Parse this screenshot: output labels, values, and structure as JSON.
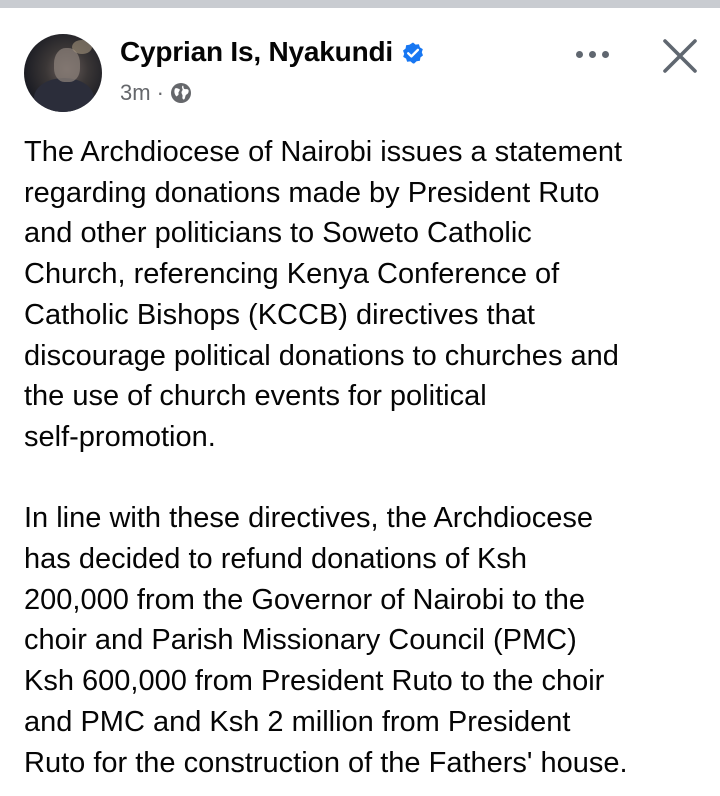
{
  "post": {
    "author": {
      "name": "Cyprian Is, Nyakundi",
      "verified_badge_icon": "verified-badge-icon",
      "avatar_icon": "profile-photo"
    },
    "timestamp": "3m",
    "separator": "·",
    "audience_icon": "globe-icon",
    "actions": {
      "more_icon": "more-options-icon",
      "close_icon": "close-icon"
    },
    "body": {
      "paragraph_1_lines": [
        "The Archdiocese of Nairobi issues a statement",
        "regarding donations made by President Ruto",
        "and other politicians to Soweto Catholic",
        "Church, referencing Kenya Conference of",
        "Catholic Bishops (KCCB) directives that",
        "discourage political donations to churches and",
        "the use of church events for political",
        "self-promotion."
      ],
      "paragraph_2_lines": [
        "In line with these directives, the Archdiocese",
        "has decided to refund donations of Ksh",
        "200,000 from the Governor of Nairobi to the",
        "choir and Parish Missionary Council (PMC)",
        "Ksh 600,000 from President Ruto to the choir",
        "and PMC and Ksh 2 million from President",
        "Ruto for the construction of the Fathers' house."
      ]
    }
  },
  "colors": {
    "divider": "#c9ccd1",
    "verified_blue": "#1877f2",
    "secondary_text": "#65676b",
    "primary_text": "#050505"
  }
}
